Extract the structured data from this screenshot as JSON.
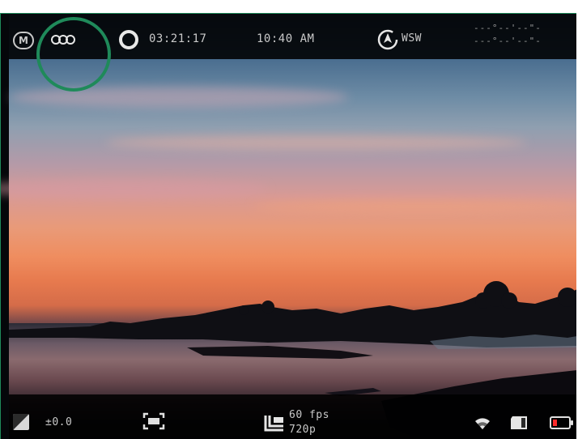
{
  "top_bar": {
    "mode_badge": "M",
    "record_timer": "03:21:17",
    "clock": "10:40 AM",
    "compass_heading": "WSW",
    "gps_lat": "---°--'--\"-",
    "gps_lon": "---°--'--\"-"
  },
  "bottom_bar": {
    "exposure_value": "±0.0",
    "frame_rate": "60 fps",
    "resolution": "720p",
    "battery_level_fraction": 0.15
  },
  "colors": {
    "accent_border": "#1f8a5a",
    "battery_low": "#ff2b2b",
    "hud_text": "#c9c9c9"
  },
  "icons": {
    "mode": "manual-mode-icon",
    "lenses": "lens-selector-icon",
    "record": "record-icon",
    "compass": "compass-icon",
    "exposure": "exposure-compensation-icon",
    "framing": "frame-guide-icon",
    "video_format": "video-format-icon",
    "wifi": "wifi-icon",
    "storage": "sd-card-icon",
    "battery": "battery-icon"
  }
}
